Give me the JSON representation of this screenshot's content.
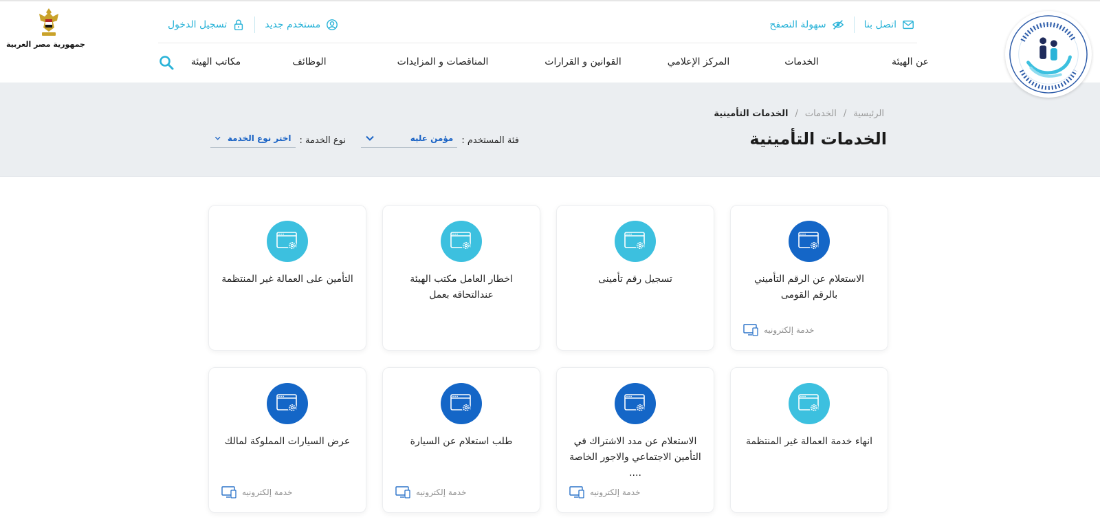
{
  "header": {
    "org_logo_text": "الهيئة القومية للتأمين الاجتماعي - National Organization for Social Insurance",
    "egypt_label": "جمهورية مصر العربية",
    "top_right_links": [
      {
        "label": "اتصل بنا",
        "icon": "mail-icon"
      },
      {
        "label": "سهولة التصفح",
        "icon": "eye-slash-icon"
      }
    ],
    "top_left_links": [
      {
        "label": "مستخدم جديد",
        "icon": "user-circle-icon"
      },
      {
        "label": "تسجيل الدخول",
        "icon": "lock-icon"
      }
    ],
    "nav": [
      "عن الهيئة",
      "الخدمات",
      "المركز الإعلامي",
      "القوانين و القرارات",
      "المناقصات و المزايدات",
      "الوظائف",
      "مكاتب الهيئة"
    ]
  },
  "banner": {
    "breadcrumb": [
      "الرئيسية",
      "/",
      "الخدمات",
      "/",
      "الخدمات التأمينية"
    ],
    "title": "الخدمات التأمينية",
    "user_filter": {
      "label": "فئة المستخدم :",
      "value": "مؤمن عليه"
    },
    "service_filter": {
      "label": "نوع الخدمة :",
      "value": "اختر نوع الخدمة"
    }
  },
  "colors": {
    "accent_cyan": "#2ab3d8",
    "icon_light": "#3cc0df",
    "icon_dark": "#1466c7",
    "banner_bg": "#ebeef1"
  },
  "cards": [
    {
      "title": "الاستعلام عن الرقم التأميني بالرقم القومى",
      "icon_style": "dark",
      "footer": "خدمة إلكترونيه"
    },
    {
      "title": "تسجيل رقم تأمينى",
      "icon_style": "light",
      "footer": ""
    },
    {
      "title": "اخطار العامل مكتب الهيئة عندالتحاقه بعمل",
      "icon_style": "light",
      "footer": ""
    },
    {
      "title": "التأمين على العمالة غير المنتظمة",
      "icon_style": "light",
      "footer": ""
    },
    {
      "title": "انهاء خدمة العمالة غير المنتظمة",
      "icon_style": "light",
      "footer": ""
    },
    {
      "title": "الاستعلام عن مدد الاشتراك في التأمين الاجتماعي والاجور الخاصة ....",
      "icon_style": "dark",
      "footer": "خدمة إلكترونيه"
    },
    {
      "title": "طلب استعلام عن السيارة",
      "icon_style": "dark",
      "footer": "خدمة إلكترونيه"
    },
    {
      "title": "عرض السيارات المملوكة لمالك",
      "icon_style": "dark",
      "footer": "خدمة إلكترونيه"
    }
  ]
}
